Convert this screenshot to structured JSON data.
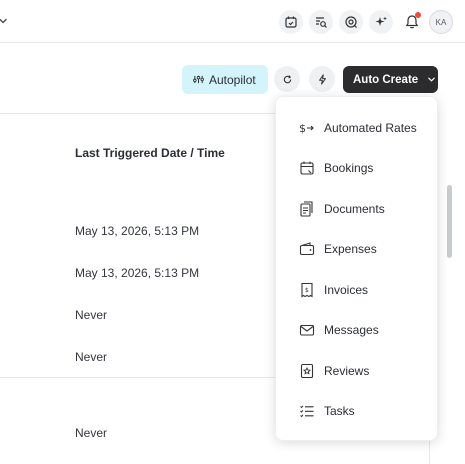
{
  "topbar": {
    "icons": [
      "calendar-check-icon",
      "search-list-icon",
      "target-settings-icon",
      "sparkles-icon",
      "bell-icon"
    ],
    "avatar_initials": "KA"
  },
  "toolbar": {
    "autopilot_label": "Autopilot",
    "auto_create_label": "Auto Create"
  },
  "table": {
    "column_header": "Last Triggered Date / Time",
    "rows": [
      "May 13, 2026, 5:13 PM",
      "May 13, 2026, 5:13 PM",
      "Never",
      "Never",
      "Never"
    ]
  },
  "auto_create_menu": {
    "items": [
      {
        "label": "Automated Rates",
        "icon": "dollar-arrow-icon"
      },
      {
        "label": "Bookings",
        "icon": "calendar-icon"
      },
      {
        "label": "Documents",
        "icon": "documents-icon"
      },
      {
        "label": "Expenses",
        "icon": "wallet-icon"
      },
      {
        "label": "Invoices",
        "icon": "invoice-icon"
      },
      {
        "label": "Messages",
        "icon": "envelope-icon"
      },
      {
        "label": "Reviews",
        "icon": "star-doc-icon"
      },
      {
        "label": "Tasks",
        "icon": "checklist-icon"
      }
    ]
  },
  "colors": {
    "autopilot_bg": "#d4f4fb",
    "auto_create_bg": "#2c2c2e",
    "notification_dot": "#ef4b3f"
  }
}
